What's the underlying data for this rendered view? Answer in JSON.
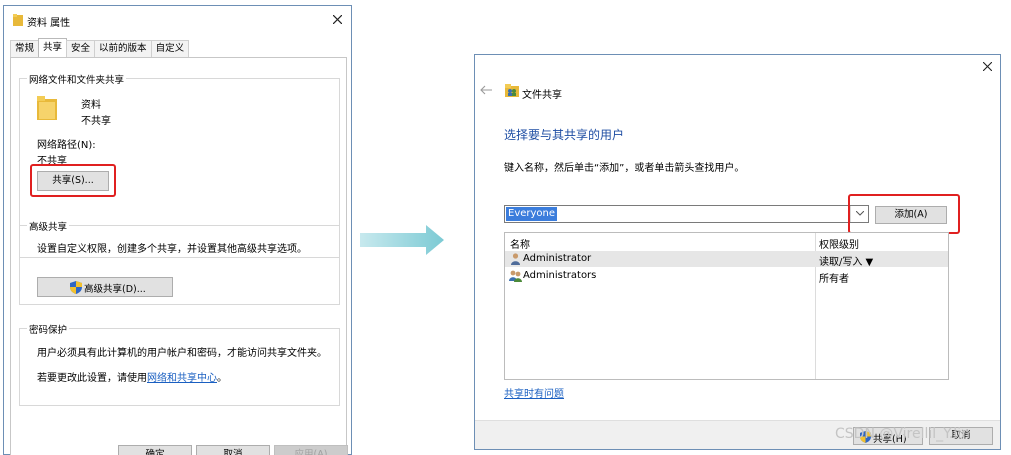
{
  "left_dialog": {
    "title": "资料 属性",
    "tabs": [
      "常规",
      "共享",
      "安全",
      "以前的版本",
      "自定义"
    ],
    "active_tab": "共享",
    "network_sharing": {
      "group_title": "网络文件和文件夹共享",
      "folder_name": "资料",
      "folder_status": "不共享",
      "path_label": "网络路径(N):",
      "path_value": "不共享",
      "share_button": "共享(S)..."
    },
    "advanced_sharing": {
      "group_title": "高级共享",
      "description": "设置自定义权限，创建多个共享，并设置其他高级共享选项。",
      "button": "高级共享(D)..."
    },
    "password": {
      "group_title": "密码保护",
      "description": "用户必须具有此计算机的用户帐户和密码，才能访问共享文件夹。",
      "change_prefix": "若要更改此设置，请使用",
      "change_link": "网络和共享中心",
      "change_suffix": "。"
    },
    "buttons": {
      "ok": "确定",
      "cancel": "取消",
      "apply": "应用(A)"
    }
  },
  "right_dialog": {
    "title": "文件共享",
    "heading": "选择要与其共享的用户",
    "instruction": "键入名称，然后单击“添加”，或者单击箭头查找用户。",
    "input_value": "Everyone",
    "add_button": "添加(A)",
    "table": {
      "columns": [
        "名称",
        "权限级别"
      ],
      "rows": [
        {
          "name": "Administrator",
          "permission": "读取/写入 ▼",
          "selected": true
        },
        {
          "name": "Administrators",
          "permission": "所有者",
          "selected": false
        }
      ]
    },
    "help_link": "共享时有问题",
    "buttons": {
      "share": "共享(H)",
      "cancel": "取消"
    }
  },
  "watermark": "CSDN @Virellil_Y.lin",
  "colors": {
    "highlight": "#e02020",
    "arrow": "#8fd0d8",
    "heading": "#1f4ea3",
    "selection": "#3b7ddc",
    "link": "#1a5fc1"
  },
  "icons": [
    "folder-icon",
    "close-icon",
    "back-arrow-icon",
    "users-folder-icon",
    "shield-icon",
    "user-icon",
    "group-icon",
    "dropdown-chevron-icon",
    "right-arrow-icon"
  ]
}
